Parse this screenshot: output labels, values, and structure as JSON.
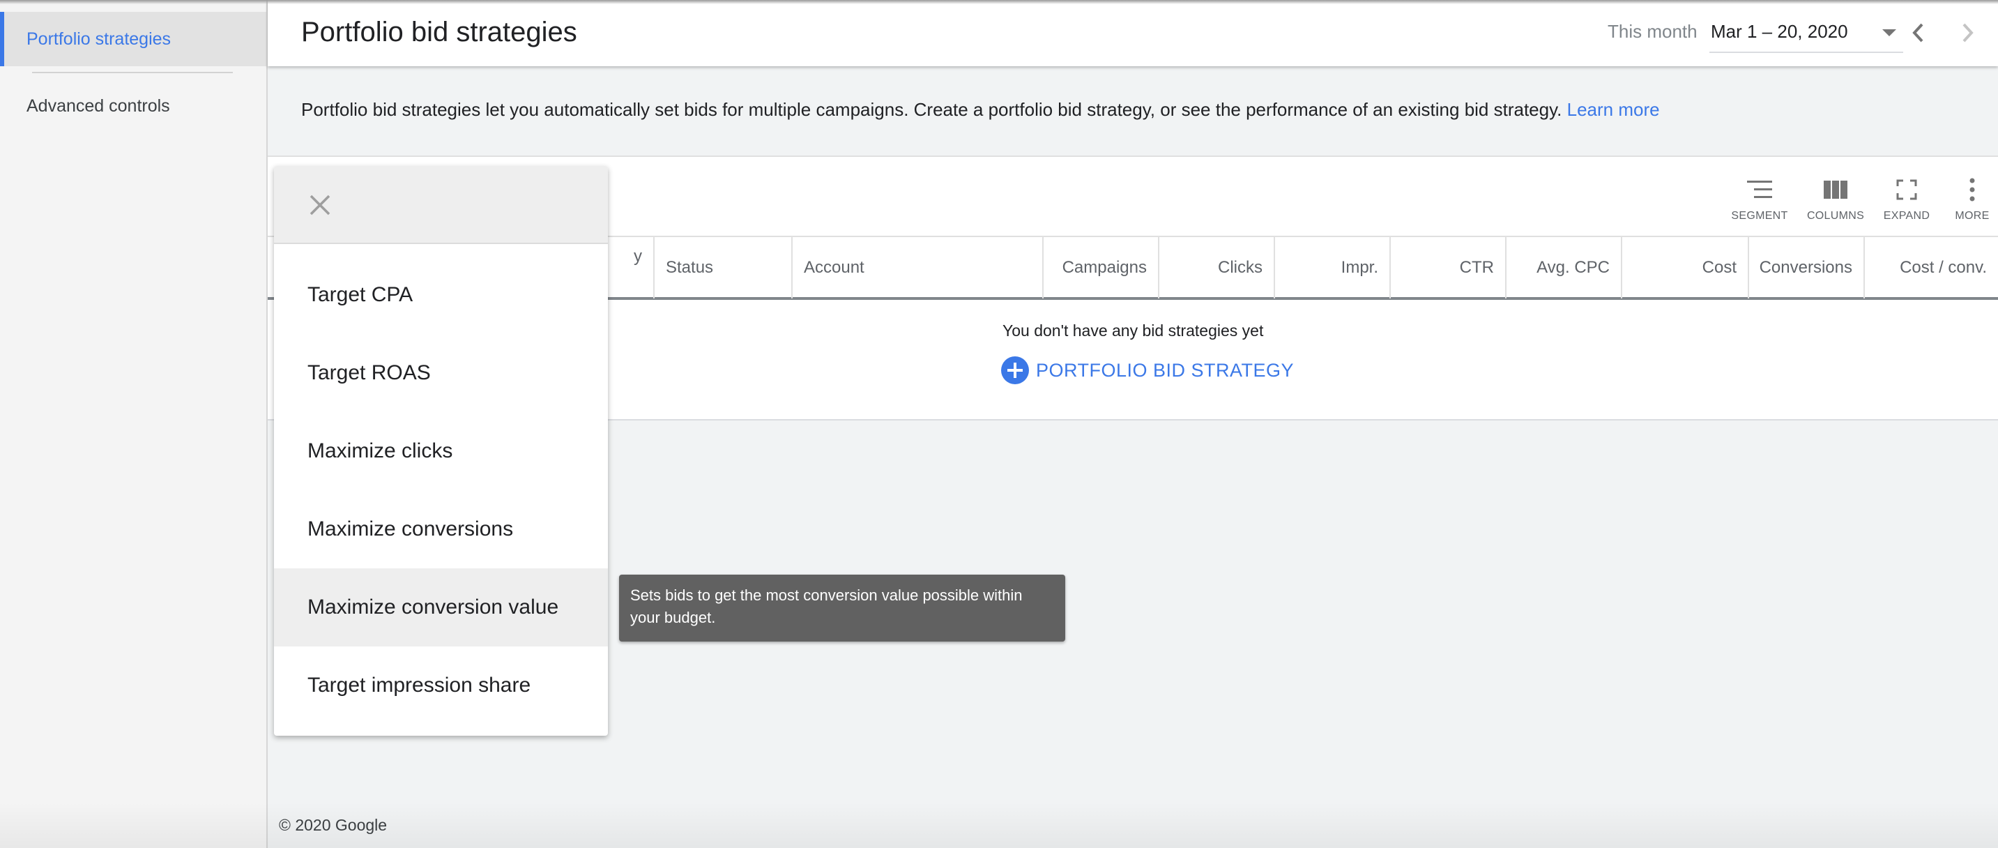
{
  "sidebar": {
    "items": [
      {
        "label": "Portfolio strategies",
        "active": true
      },
      {
        "label": "Advanced controls",
        "active": false
      }
    ]
  },
  "header": {
    "title": "Portfolio bid strategies",
    "date_range_label": "This month",
    "date_range_value": "Mar 1 – 20, 2020",
    "prev_icon": "chevron-left-icon",
    "next_icon": "chevron-right-icon"
  },
  "description": {
    "text": "Portfolio bid strategies let you automatically set bids for multiple campaigns. Create a portfolio bid strategy, or see the performance of an existing bid strategy.",
    "link": "Learn more"
  },
  "toolbar": {
    "segment": "SEGMENT",
    "columns": "COLUMNS",
    "expand": "EXPAND",
    "more": "MORE"
  },
  "table": {
    "columns": [
      "Portfolio bid strategy",
      "Status",
      "Account",
      "Campaigns",
      "Clicks",
      "Impr.",
      "CTR",
      "Avg. CPC",
      "Cost",
      "Conversions",
      "Cost / conv."
    ],
    "partial_first_column_text": "y",
    "empty_message": "You don't have any bid strategies yet",
    "add_button": "PORTFOLIO BID STRATEGY"
  },
  "menu": {
    "close_icon": "close-icon",
    "items": [
      "Target CPA",
      "Target ROAS",
      "Maximize clicks",
      "Maximize conversions",
      "Maximize conversion value",
      "Target impression share"
    ],
    "hovered_index": 4
  },
  "tooltip": {
    "text": "Sets bids to get the most conversion value possible within your budget."
  },
  "footer": {
    "copyright": "© 2020 Google"
  },
  "colors": {
    "accent": "#3b78e7",
    "tooltip_bg": "#616161",
    "page_bg": "#f1f3f4"
  }
}
